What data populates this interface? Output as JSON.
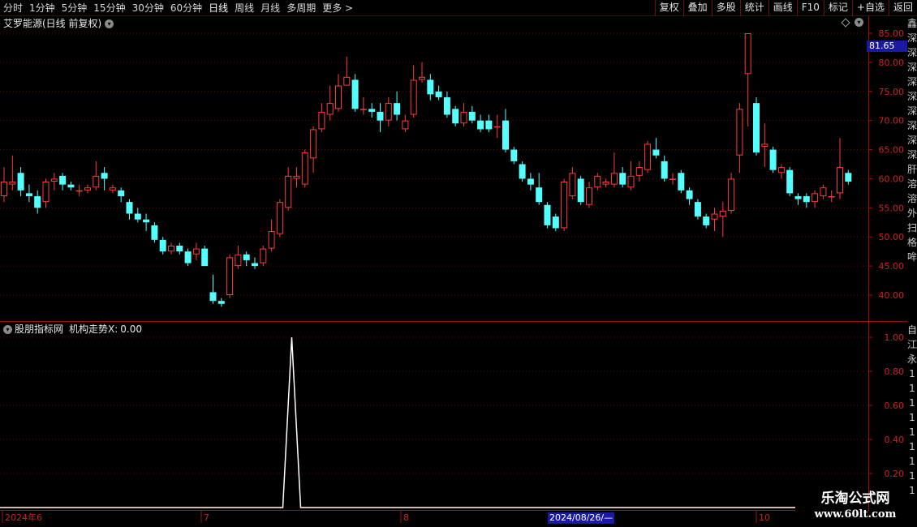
{
  "toolbar": {
    "periods": [
      "分时",
      "1分钟",
      "5分钟",
      "15分钟",
      "30分钟",
      "60分钟",
      "日线",
      "周线",
      "月线",
      "多周期",
      "更多"
    ],
    "more_arrow": ">",
    "buttons": [
      "复权",
      "叠加",
      "多股",
      "统计",
      "画线",
      "F10",
      "标记",
      "+自选",
      "返回"
    ]
  },
  "main_panel": {
    "title": "艾罗能源(日线 前复权)",
    "current_price": "81.65",
    "price_axis": [
      "85.00",
      "80.00",
      "75.00",
      "70.00",
      "65.00",
      "60.00",
      "55.00",
      "50.00",
      "45.00",
      "40.00"
    ]
  },
  "indicator_panel": {
    "title": "股朋指标网",
    "name": "机构走势X:",
    "value": "0.00",
    "axis": [
      "1.00",
      "0.80",
      "0.60",
      "0.40",
      "0.20"
    ]
  },
  "date_axis": {
    "labels": [
      "2024年6",
      "7",
      "8",
      "10"
    ],
    "cursor_date": "2024/08/26/—"
  },
  "side_strip_chars": [
    "鑫",
    "深",
    "深",
    "深",
    "深",
    "深",
    "深",
    "深",
    "深",
    "深",
    "肝",
    "溶",
    "溶",
    "外",
    "扫",
    "格",
    "哞"
  ],
  "side_strip_chars2": [
    "自",
    "江",
    "永",
    "1",
    "1",
    "1",
    "1",
    "1",
    "1",
    "1",
    "1",
    "1"
  ],
  "watermark": {
    "line1": "乐淘公式网",
    "line2": "www.60lt.com"
  },
  "colors": {
    "up": "#ff3b3b",
    "down": "#54ffff",
    "grid": "#6a0000",
    "axis_text": "#d02020"
  },
  "chart_data": {
    "type": "candlestick",
    "ylim": [
      37,
      87
    ],
    "candles": [
      {
        "o": 57,
        "c": 59.5,
        "h": 62,
        "l": 56
      },
      {
        "o": 59,
        "c": 59.5,
        "h": 64,
        "l": 58
      },
      {
        "o": 61,
        "c": 58,
        "h": 62,
        "l": 57
      },
      {
        "o": 57.5,
        "c": 57,
        "h": 59,
        "l": 56
      },
      {
        "o": 57,
        "c": 55,
        "h": 58,
        "l": 54
      },
      {
        "o": 56,
        "c": 59.5,
        "h": 60,
        "l": 55
      },
      {
        "o": 59.5,
        "c": 60,
        "h": 61,
        "l": 58
      },
      {
        "o": 60.5,
        "c": 59,
        "h": 61,
        "l": 58
      },
      {
        "o": 59,
        "c": 58.5,
        "h": 59.5,
        "l": 58
      },
      {
        "o": 58,
        "c": 58,
        "h": 59,
        "l": 57
      },
      {
        "o": 58,
        "c": 58.5,
        "h": 59,
        "l": 57.5
      },
      {
        "o": 58.5,
        "c": 60.5,
        "h": 63,
        "l": 58
      },
      {
        "o": 61,
        "c": 60,
        "h": 62,
        "l": 58
      },
      {
        "o": 58,
        "c": 58.5,
        "h": 59,
        "l": 57.5
      },
      {
        "o": 58,
        "c": 57,
        "h": 58.5,
        "l": 56
      },
      {
        "o": 56,
        "c": 54,
        "h": 56.5,
        "l": 53
      },
      {
        "o": 54,
        "c": 53,
        "h": 55,
        "l": 52.5
      },
      {
        "o": 53,
        "c": 52.5,
        "h": 54,
        "l": 51
      },
      {
        "o": 52,
        "c": 49.5,
        "h": 52.5,
        "l": 49
      },
      {
        "o": 49.5,
        "c": 47.5,
        "h": 50,
        "l": 47
      },
      {
        "o": 47.5,
        "c": 48.5,
        "h": 49,
        "l": 47
      },
      {
        "o": 48.5,
        "c": 47.5,
        "h": 49,
        "l": 47
      },
      {
        "o": 47.5,
        "c": 45.5,
        "h": 48,
        "l": 45
      },
      {
        "o": 47,
        "c": 48,
        "h": 49,
        "l": 46
      },
      {
        "o": 48,
        "c": 45,
        "h": 48.5,
        "l": 45
      },
      {
        "o": 40.5,
        "c": 39,
        "h": 43.5,
        "l": 38.5
      },
      {
        "o": 39,
        "c": 38.5,
        "h": 39.5,
        "l": 38
      },
      {
        "o": 40,
        "c": 46.5,
        "h": 47,
        "l": 39.5
      },
      {
        "o": 45,
        "c": 47,
        "h": 48.5,
        "l": 44.5
      },
      {
        "o": 47,
        "c": 46,
        "h": 47.5,
        "l": 45
      },
      {
        "o": 45.5,
        "c": 45,
        "h": 46.5,
        "l": 44.5
      },
      {
        "o": 45.5,
        "c": 48,
        "h": 48.5,
        "l": 45
      },
      {
        "o": 48,
        "c": 51,
        "h": 53,
        "l": 47.5
      },
      {
        "o": 50.5,
        "c": 56,
        "h": 56.5,
        "l": 50
      },
      {
        "o": 55,
        "c": 60.5,
        "h": 62,
        "l": 54.5
      },
      {
        "o": 60,
        "c": 60.5,
        "h": 62,
        "l": 58.5
      },
      {
        "o": 59,
        "c": 64.5,
        "h": 65,
        "l": 58.5
      },
      {
        "o": 63.5,
        "c": 68.5,
        "h": 69,
        "l": 61
      },
      {
        "o": 68.5,
        "c": 71.5,
        "h": 73,
        "l": 68
      },
      {
        "o": 71,
        "c": 73,
        "h": 76,
        "l": 70
      },
      {
        "o": 72,
        "c": 76,
        "h": 78,
        "l": 71.5
      },
      {
        "o": 76,
        "c": 77.5,
        "h": 81,
        "l": 76
      },
      {
        "o": 77,
        "c": 72,
        "h": 78,
        "l": 71.5
      },
      {
        "o": 72,
        "c": 72,
        "h": 74,
        "l": 71
      },
      {
        "o": 72,
        "c": 71.5,
        "h": 73,
        "l": 70.5
      },
      {
        "o": 71.5,
        "c": 70,
        "h": 73,
        "l": 68
      },
      {
        "o": 70,
        "c": 73,
        "h": 74,
        "l": 69
      },
      {
        "o": 73,
        "c": 71,
        "h": 75,
        "l": 70
      },
      {
        "o": 68.5,
        "c": 70,
        "h": 71,
        "l": 68
      },
      {
        "o": 71,
        "c": 77,
        "h": 79.5,
        "l": 70.5
      },
      {
        "o": 77,
        "c": 77.5,
        "h": 80,
        "l": 76.5
      },
      {
        "o": 77,
        "c": 74.5,
        "h": 78,
        "l": 73.5
      },
      {
        "o": 75,
        "c": 74,
        "h": 76,
        "l": 73.5
      },
      {
        "o": 74,
        "c": 71,
        "h": 75,
        "l": 70.5
      },
      {
        "o": 72,
        "c": 69.5,
        "h": 72.5,
        "l": 69
      },
      {
        "o": 69.5,
        "c": 71.5,
        "h": 73,
        "l": 69
      },
      {
        "o": 71.5,
        "c": 70,
        "h": 72.5,
        "l": 69.5
      },
      {
        "o": 70,
        "c": 68.5,
        "h": 71,
        "l": 68
      },
      {
        "o": 70,
        "c": 68.5,
        "h": 71,
        "l": 68
      },
      {
        "o": 69,
        "c": 69,
        "h": 71,
        "l": 67
      },
      {
        "o": 70,
        "c": 65,
        "h": 72,
        "l": 64.5
      },
      {
        "o": 65,
        "c": 63,
        "h": 65.5,
        "l": 62.5
      },
      {
        "o": 62.5,
        "c": 60,
        "h": 63,
        "l": 59.5
      },
      {
        "o": 60,
        "c": 59,
        "h": 61,
        "l": 58
      },
      {
        "o": 58.5,
        "c": 56,
        "h": 61,
        "l": 55.5
      },
      {
        "o": 55.5,
        "c": 52,
        "h": 56,
        "l": 51.5
      },
      {
        "o": 53.5,
        "c": 51.5,
        "h": 54,
        "l": 51
      },
      {
        "o": 51.5,
        "c": 59.5,
        "h": 60,
        "l": 51
      },
      {
        "o": 57,
        "c": 61,
        "h": 62,
        "l": 56.5
      },
      {
        "o": 60,
        "c": 56,
        "h": 60.5,
        "l": 55.5
      },
      {
        "o": 55.5,
        "c": 58.5,
        "h": 59.5,
        "l": 55
      },
      {
        "o": 58.5,
        "c": 60.5,
        "h": 61,
        "l": 58
      },
      {
        "o": 59,
        "c": 59.5,
        "h": 60,
        "l": 58.5
      },
      {
        "o": 59,
        "c": 61,
        "h": 64.5,
        "l": 58.5
      },
      {
        "o": 61,
        "c": 59,
        "h": 62,
        "l": 58.5
      },
      {
        "o": 58.5,
        "c": 60.5,
        "h": 63,
        "l": 58
      },
      {
        "o": 60.5,
        "c": 62,
        "h": 63,
        "l": 59.5
      },
      {
        "o": 61.5,
        "c": 66,
        "h": 66.5,
        "l": 61
      },
      {
        "o": 65,
        "c": 64,
        "h": 67,
        "l": 63.5
      },
      {
        "o": 63,
        "c": 60,
        "h": 64,
        "l": 59.5
      },
      {
        "o": 60,
        "c": 60,
        "h": 61,
        "l": 59
      },
      {
        "o": 61,
        "c": 58,
        "h": 61.5,
        "l": 57.5
      },
      {
        "o": 58,
        "c": 56.5,
        "h": 58.5,
        "l": 55.5
      },
      {
        "o": 56,
        "c": 53.5,
        "h": 56.5,
        "l": 53
      },
      {
        "o": 53.5,
        "c": 52,
        "h": 54,
        "l": 51.5
      },
      {
        "o": 53,
        "c": 54,
        "h": 55,
        "l": 51
      },
      {
        "o": 53.5,
        "c": 54.5,
        "h": 56,
        "l": 50
      },
      {
        "o": 54.5,
        "c": 60,
        "h": 61,
        "l": 54
      },
      {
        "o": 64,
        "c": 72,
        "h": 73,
        "l": 61
      },
      {
        "o": 78,
        "c": 85,
        "h": 85,
        "l": 69
      },
      {
        "o": 73,
        "c": 64.5,
        "h": 74,
        "l": 64
      },
      {
        "o": 65.5,
        "c": 66,
        "h": 69.5,
        "l": 62
      },
      {
        "o": 65,
        "c": 61.5,
        "h": 65.5,
        "l": 61
      },
      {
        "o": 61,
        "c": 62,
        "h": 62.5,
        "l": 60
      },
      {
        "o": 61.5,
        "c": 57.5,
        "h": 62,
        "l": 57
      },
      {
        "o": 57,
        "c": 56.5,
        "h": 57.5,
        "l": 55.5
      },
      {
        "o": 57,
        "c": 56,
        "h": 57.5,
        "l": 55
      },
      {
        "o": 56,
        "c": 57.5,
        "h": 58,
        "l": 55
      },
      {
        "o": 57,
        "c": 58.5,
        "h": 59,
        "l": 56.5
      },
      {
        "o": 57,
        "c": 57,
        "h": 58,
        "l": 56
      },
      {
        "o": 57.5,
        "c": 62,
        "h": 67,
        "l": 56.5
      },
      {
        "o": 61,
        "c": 59.5,
        "h": 61.5,
        "l": 59
      }
    ],
    "indicator": {
      "name": "机构走势X",
      "ylim": [
        0,
        1
      ],
      "spike_index": 25,
      "spike_value": 1.0,
      "baseline": 0
    }
  }
}
